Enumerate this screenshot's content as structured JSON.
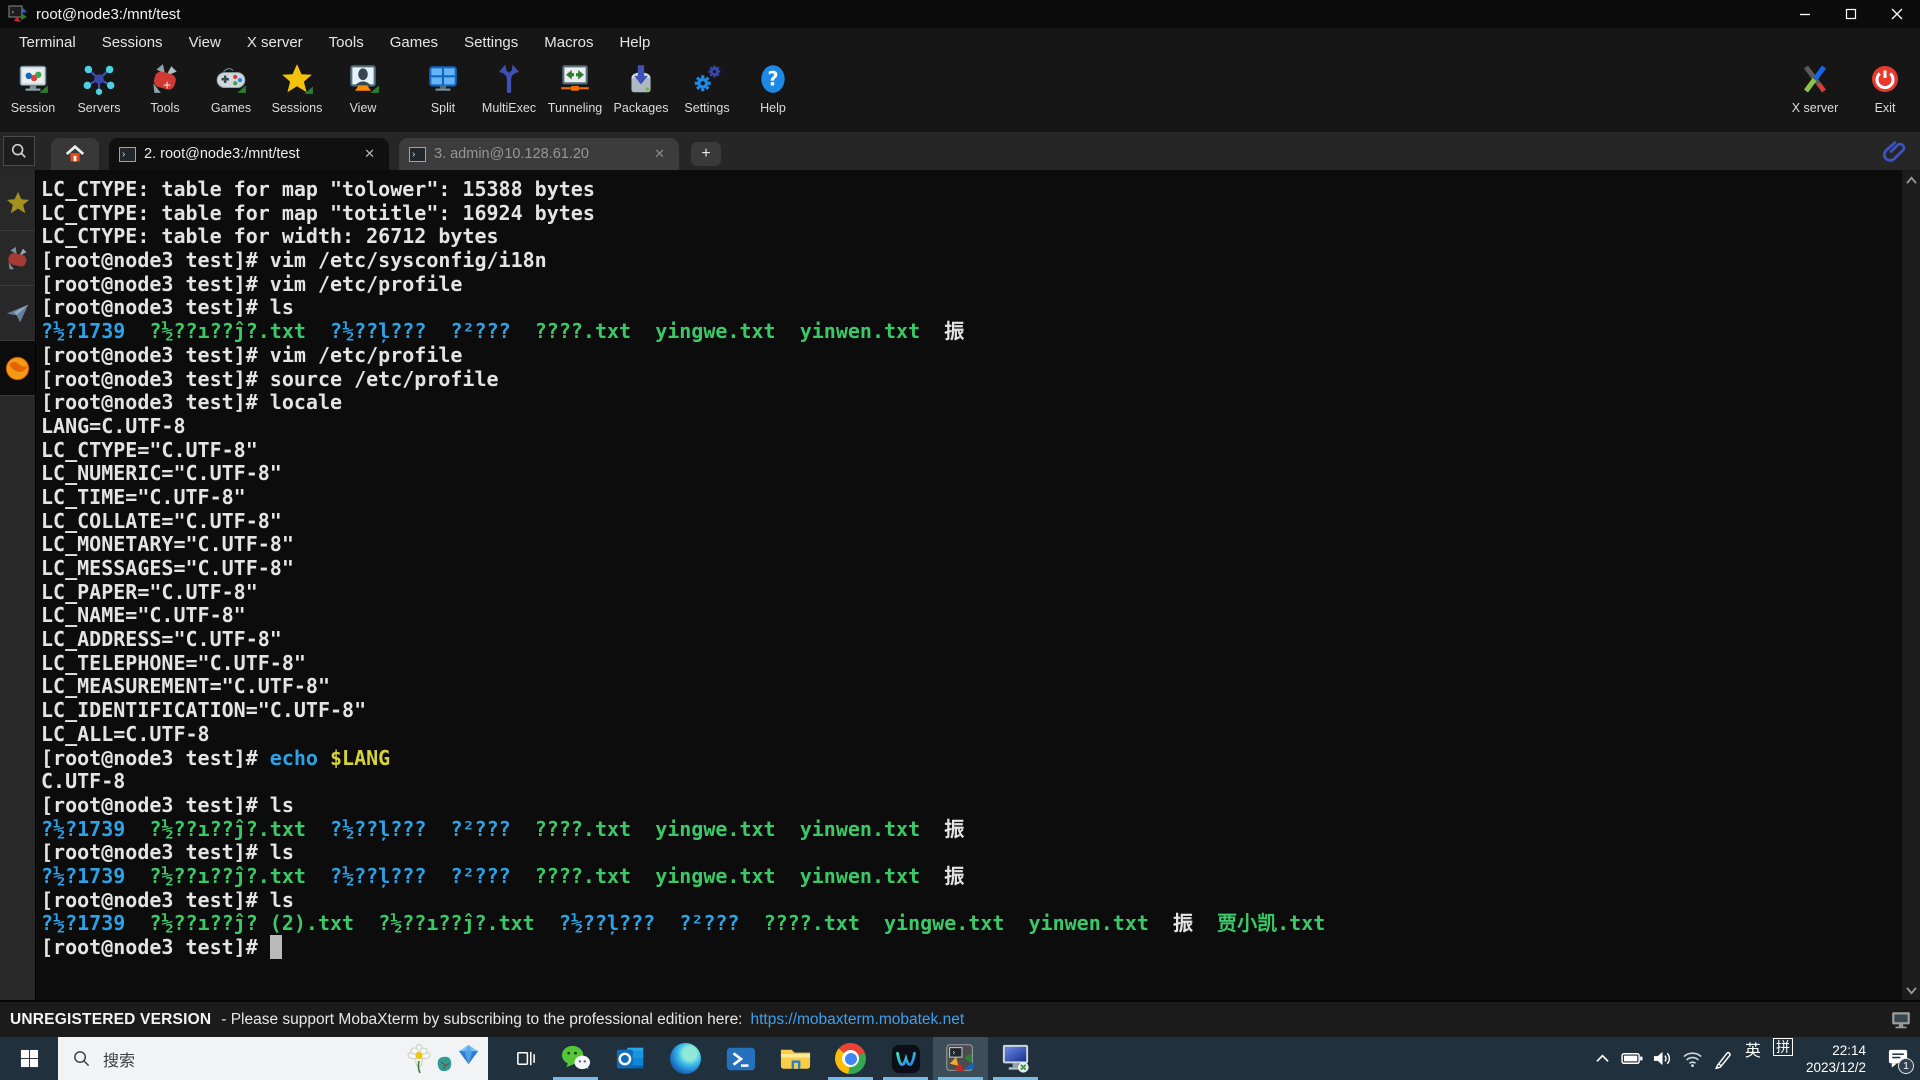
{
  "window": {
    "title": "root@node3:/mnt/test"
  },
  "menu": {
    "items": [
      "Terminal",
      "Sessions",
      "View",
      "X server",
      "Tools",
      "Games",
      "Settings",
      "Macros",
      "Help"
    ]
  },
  "toolbar": {
    "items": [
      {
        "label": "Session",
        "icon": "session-monitor-icon"
      },
      {
        "label": "Servers",
        "icon": "servers-network-icon"
      },
      {
        "label": "Tools",
        "icon": "swiss-knife-icon"
      },
      {
        "label": "Games",
        "icon": "gamepad-icon"
      },
      {
        "label": "Sessions",
        "icon": "star-icon"
      },
      {
        "label": "View",
        "icon": "user-view-icon"
      },
      {
        "label": "Split",
        "icon": "split-window-icon"
      },
      {
        "label": "MultiExec",
        "icon": "fork-arrows-icon"
      },
      {
        "label": "Tunneling",
        "icon": "tunnel-arrows-icon"
      },
      {
        "label": "Packages",
        "icon": "package-drive-icon"
      },
      {
        "label": "Settings",
        "icon": "gears-icon"
      },
      {
        "label": "Help",
        "icon": "question-icon"
      }
    ],
    "right_items": [
      {
        "label": "X server",
        "icon": "x-server-icon"
      },
      {
        "label": "Exit",
        "icon": "power-icon"
      }
    ]
  },
  "tabbar": {
    "close_glyph": "✕",
    "new_tab_glyph": "+",
    "tabs": [
      {
        "label": "2. root@node3:/mnt/test",
        "state": "active"
      },
      {
        "label": "3. admin@10.128.61.20",
        "state": "inactive"
      }
    ]
  },
  "sidebar": {
    "icons": [
      "star-icon",
      "swiss-knife-icon",
      "paper-plane-icon",
      "globe-icon"
    ]
  },
  "terminal": {
    "colors": {
      "white": "#e4e4e4",
      "cyan": "#2ba3e8",
      "green": "#3bc968",
      "yellow": "#d6d43a"
    },
    "lines": [
      [
        {
          "t": "LC_CTYPE: table for map \"tolower\": 15388 bytes",
          "c": "w"
        }
      ],
      [
        {
          "t": "LC_CTYPE: table for map \"totitle\": 16924 bytes",
          "c": "w"
        }
      ],
      [
        {
          "t": "LC_CTYPE: table for width: 26712 bytes",
          "c": "w"
        }
      ],
      [
        {
          "t": "[root@node3 test]# vim /etc/sysconfig/i18n",
          "c": "w"
        }
      ],
      [
        {
          "t": "[root@node3 test]# vim /etc/profile",
          "c": "w"
        }
      ],
      [
        {
          "t": "[root@node3 test]# ls",
          "c": "w"
        }
      ],
      [
        {
          "t": "?½?1739",
          "c": "c"
        },
        {
          "t": "  ",
          "c": "w"
        },
        {
          "t": "?½??ı??ĵ?.txt",
          "c": "g"
        },
        {
          "t": "  ",
          "c": "w"
        },
        {
          "t": "?½??ļ???",
          "c": "c"
        },
        {
          "t": "  ",
          "c": "w"
        },
        {
          "t": "?²???",
          "c": "c"
        },
        {
          "t": "  ",
          "c": "w"
        },
        {
          "t": "????.txt",
          "c": "g"
        },
        {
          "t": "  ",
          "c": "w"
        },
        {
          "t": "yingwe.txt",
          "c": "g"
        },
        {
          "t": "  ",
          "c": "w"
        },
        {
          "t": "yinwen.txt",
          "c": "g"
        },
        {
          "t": "  ",
          "c": "w"
        },
        {
          "t": "振",
          "c": "w"
        }
      ],
      [
        {
          "t": "[root@node3 test]# vim /etc/profile",
          "c": "w"
        }
      ],
      [
        {
          "t": "[root@node3 test]# source /etc/profile",
          "c": "w"
        }
      ],
      [
        {
          "t": "[root@node3 test]# locale",
          "c": "w"
        }
      ],
      [
        {
          "t": "LANG=C.UTF-8",
          "c": "w"
        }
      ],
      [
        {
          "t": "LC_CTYPE=\"C.UTF-8\"",
          "c": "w"
        }
      ],
      [
        {
          "t": "LC_NUMERIC=\"C.UTF-8\"",
          "c": "w"
        }
      ],
      [
        {
          "t": "LC_TIME=\"C.UTF-8\"",
          "c": "w"
        }
      ],
      [
        {
          "t": "LC_COLLATE=\"C.UTF-8\"",
          "c": "w"
        }
      ],
      [
        {
          "t": "LC_MONETARY=\"C.UTF-8\"",
          "c": "w"
        }
      ],
      [
        {
          "t": "LC_MESSAGES=\"C.UTF-8\"",
          "c": "w"
        }
      ],
      [
        {
          "t": "LC_PAPER=\"C.UTF-8\"",
          "c": "w"
        }
      ],
      [
        {
          "t": "LC_NAME=\"C.UTF-8\"",
          "c": "w"
        }
      ],
      [
        {
          "t": "LC_ADDRESS=\"C.UTF-8\"",
          "c": "w"
        }
      ],
      [
        {
          "t": "LC_TELEPHONE=\"C.UTF-8\"",
          "c": "w"
        }
      ],
      [
        {
          "t": "LC_MEASUREMENT=\"C.UTF-8\"",
          "c": "w"
        }
      ],
      [
        {
          "t": "LC_IDENTIFICATION=\"C.UTF-8\"",
          "c": "w"
        }
      ],
      [
        {
          "t": "LC_ALL=C.UTF-8",
          "c": "w"
        }
      ],
      [
        {
          "t": "[root@node3 test]# ",
          "c": "w"
        },
        {
          "t": "echo",
          "c": "c"
        },
        {
          "t": " ",
          "c": "w"
        },
        {
          "t": "$LANG",
          "c": "y"
        }
      ],
      [
        {
          "t": "C.UTF-8",
          "c": "w"
        }
      ],
      [
        {
          "t": "[root@node3 test]# ls",
          "c": "w"
        }
      ],
      [
        {
          "t": "?½?1739",
          "c": "c"
        },
        {
          "t": "  ",
          "c": "w"
        },
        {
          "t": "?½??ı??ĵ?.txt",
          "c": "g"
        },
        {
          "t": "  ",
          "c": "w"
        },
        {
          "t": "?½??ļ???",
          "c": "c"
        },
        {
          "t": "  ",
          "c": "w"
        },
        {
          "t": "?²???",
          "c": "c"
        },
        {
          "t": "  ",
          "c": "w"
        },
        {
          "t": "????.txt",
          "c": "g"
        },
        {
          "t": "  ",
          "c": "w"
        },
        {
          "t": "yingwe.txt",
          "c": "g"
        },
        {
          "t": "  ",
          "c": "w"
        },
        {
          "t": "yinwen.txt",
          "c": "g"
        },
        {
          "t": "  ",
          "c": "w"
        },
        {
          "t": "振",
          "c": "w"
        }
      ],
      [
        {
          "t": "[root@node3 test]# ls",
          "c": "w"
        }
      ],
      [
        {
          "t": "?½?1739",
          "c": "c"
        },
        {
          "t": "  ",
          "c": "w"
        },
        {
          "t": "?½??ı??ĵ?.txt",
          "c": "g"
        },
        {
          "t": "  ",
          "c": "w"
        },
        {
          "t": "?½??ļ???",
          "c": "c"
        },
        {
          "t": "  ",
          "c": "w"
        },
        {
          "t": "?²???",
          "c": "c"
        },
        {
          "t": "  ",
          "c": "w"
        },
        {
          "t": "????.txt",
          "c": "g"
        },
        {
          "t": "  ",
          "c": "w"
        },
        {
          "t": "yingwe.txt",
          "c": "g"
        },
        {
          "t": "  ",
          "c": "w"
        },
        {
          "t": "yinwen.txt",
          "c": "g"
        },
        {
          "t": "  ",
          "c": "w"
        },
        {
          "t": "振",
          "c": "w"
        }
      ],
      [
        {
          "t": "[root@node3 test]# ls",
          "c": "w"
        }
      ],
      [
        {
          "t": "?½?1739",
          "c": "c"
        },
        {
          "t": "  ",
          "c": "w"
        },
        {
          "t": "?½??ı??ĵ? (2).txt",
          "c": "g"
        },
        {
          "t": "  ",
          "c": "w"
        },
        {
          "t": "?½??ı??ĵ?.txt",
          "c": "g"
        },
        {
          "t": "  ",
          "c": "w"
        },
        {
          "t": "?½??ļ???",
          "c": "c"
        },
        {
          "t": "  ",
          "c": "w"
        },
        {
          "t": "?²???",
          "c": "c"
        },
        {
          "t": "  ",
          "c": "w"
        },
        {
          "t": "????.txt",
          "c": "g"
        },
        {
          "t": "  ",
          "c": "w"
        },
        {
          "t": "yingwe.txt",
          "c": "g"
        },
        {
          "t": "  ",
          "c": "w"
        },
        {
          "t": "yinwen.txt",
          "c": "g"
        },
        {
          "t": "  ",
          "c": "w"
        },
        {
          "t": "振",
          "c": "w"
        },
        {
          "t": "  ",
          "c": "w"
        },
        {
          "t": "贾小凯.txt",
          "c": "g"
        }
      ],
      [
        {
          "t": "[root@node3 test]# ",
          "c": "w"
        },
        {
          "t": " ",
          "c": "cur"
        }
      ]
    ]
  },
  "statusbar": {
    "version_label": "UNREGISTERED VERSION",
    "message": "-  Please support MobaXterm by subscribing to the professional edition here:",
    "link": "https://mobaxterm.mobatek.net"
  },
  "taskbar": {
    "search": {
      "placeholder": "搜索"
    },
    "apps": [
      "wechat",
      "outlook",
      "edge",
      "powershell",
      "file-explorer",
      "chrome",
      "webex",
      "mobaxterm",
      "remote-desktop"
    ],
    "tray": {
      "icons": [
        "chevron-up",
        "battery",
        "speaker",
        "wifi",
        "pen",
        "ime-latin",
        "ime-pinyin",
        "clock",
        "notification"
      ],
      "ime_latin": "英",
      "ime_pinyin": "拼",
      "time": "22:14",
      "date": "2023/12/2",
      "notification_count": "1"
    }
  },
  "colors": {
    "taskbar_bg": "#20303c",
    "link": "#3da0f0",
    "running_indicator": "#79bbe8"
  }
}
